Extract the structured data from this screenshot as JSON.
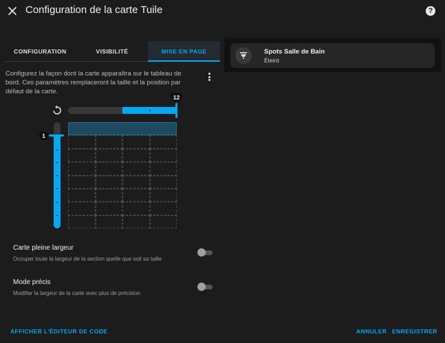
{
  "dialog": {
    "title": "Configuration de la carte Tuile",
    "help_label": "?"
  },
  "tabs": [
    {
      "label": "CONFIGURATION",
      "active": false
    },
    {
      "label": "VISIBILITÉ",
      "active": false
    },
    {
      "label": "MISE EN PAGE",
      "active": true
    }
  ],
  "layout": {
    "description": "Configurez la façon dont la carte apparaîtra sur le tableau de bord. Ces paramètres remplaceront la taille et la position par défaut de la carte.",
    "columns": {
      "value": 12,
      "label": "12",
      "min": 1,
      "max": 12
    },
    "rows": {
      "value": 1,
      "label": "1"
    },
    "options": [
      {
        "title": "Carte pleine largeur",
        "subtitle": "Occuper toute la largeur de la section quelle que soit sa taille",
        "enabled": false
      },
      {
        "title": "Mode précis",
        "subtitle": "Modifier la largeur de la carte avec plus de précision",
        "enabled": false
      }
    ]
  },
  "preview": {
    "tile": {
      "name": "Spots Salle de Bain",
      "state": "Éteint",
      "icon": "ceiling-light-icon"
    }
  },
  "footer": {
    "code_editor_label": "AFFICHER L'ÉDITEUR DE CODE",
    "cancel_label": "ANNULER",
    "save_label": "ENREGISTRER"
  },
  "colors": {
    "accent": "#03a9f4",
    "background": "#1c1c1c",
    "card": "#262626"
  },
  "icons": {
    "close": "close-icon",
    "help": "help-circle-icon",
    "menu": "dots-vertical-icon",
    "reset": "restore-icon"
  }
}
